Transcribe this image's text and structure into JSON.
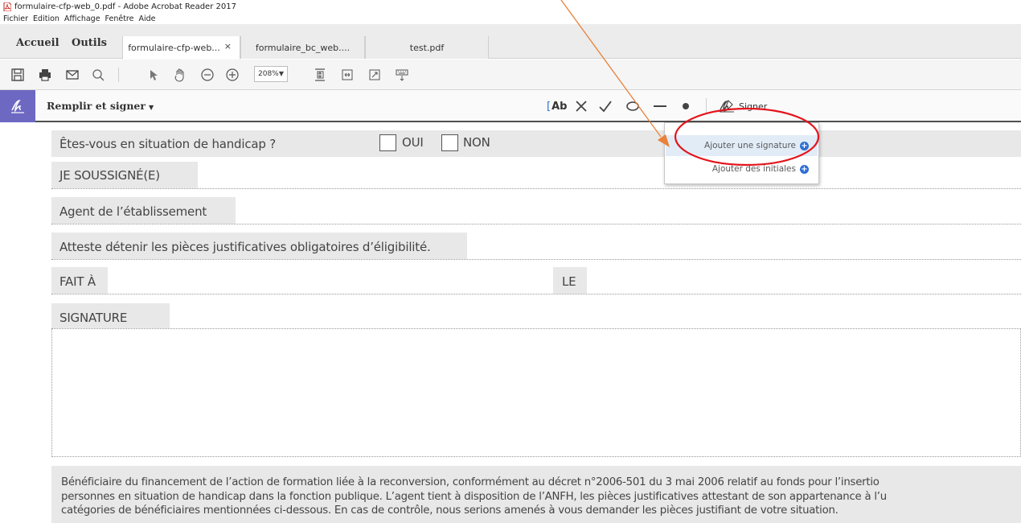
{
  "window": {
    "title": "formulaire-cfp-web_0.pdf - Adobe Acrobat Reader 2017"
  },
  "menu": [
    "Fichier",
    "Edition",
    "Affichage",
    "Fenêtre",
    "Aide"
  ],
  "nav": {
    "home": "Accueil",
    "tools": "Outils"
  },
  "tabs": [
    {
      "label": "formulaire-cfp-web...",
      "active": true
    },
    {
      "label": "formulaire_bc_web....",
      "active": false
    },
    {
      "label": "test.pdf",
      "active": false
    }
  ],
  "toolbar": {
    "zoom": "208%"
  },
  "fill_sign": {
    "label": "Remplir et signer",
    "text_tool": "Ab",
    "sign_label": "Signer"
  },
  "sign_menu": {
    "add_signature": "Ajouter une signature",
    "add_initials": "Ajouter des initiales"
  },
  "document": {
    "handicap_question": "Êtes-vous en situation de handicap ?",
    "yes": "OUI",
    "no": "NON",
    "undersigned": "JE SOUSSIGNÉ(E)",
    "agent": "Agent de l’établissement",
    "attests": "Atteste détenir les pièces justificatives obligatoires d’éligibilité.",
    "made_at": "FAIT À",
    "on": "LE",
    "signature": "SIGNATURE",
    "paragraph": [
      "Bénéficiaire du financement de l’action de formation liée à la reconversion, conformément au décret n°2006-501 du 3 mai 2006 relatif au fonds pour l’insertio",
      "personnes en situation de handicap dans la fonction publique. L’agent tient à disposition de l’ANFH, les pièces justificatives attestant de son appartenance  à l’u",
      "catégories de bénéficiaires mentionnées ci-dessous. En cas de contrôle, nous serions amenés à vous demander les pièces justifiant de votre situation."
    ]
  },
  "colors": {
    "annotation_arrow": "#e8823a",
    "annotation_ellipse": "#e4141b",
    "fill_sign_accent": "#6d68c2",
    "menu_highlight": "#e2ecf7"
  }
}
